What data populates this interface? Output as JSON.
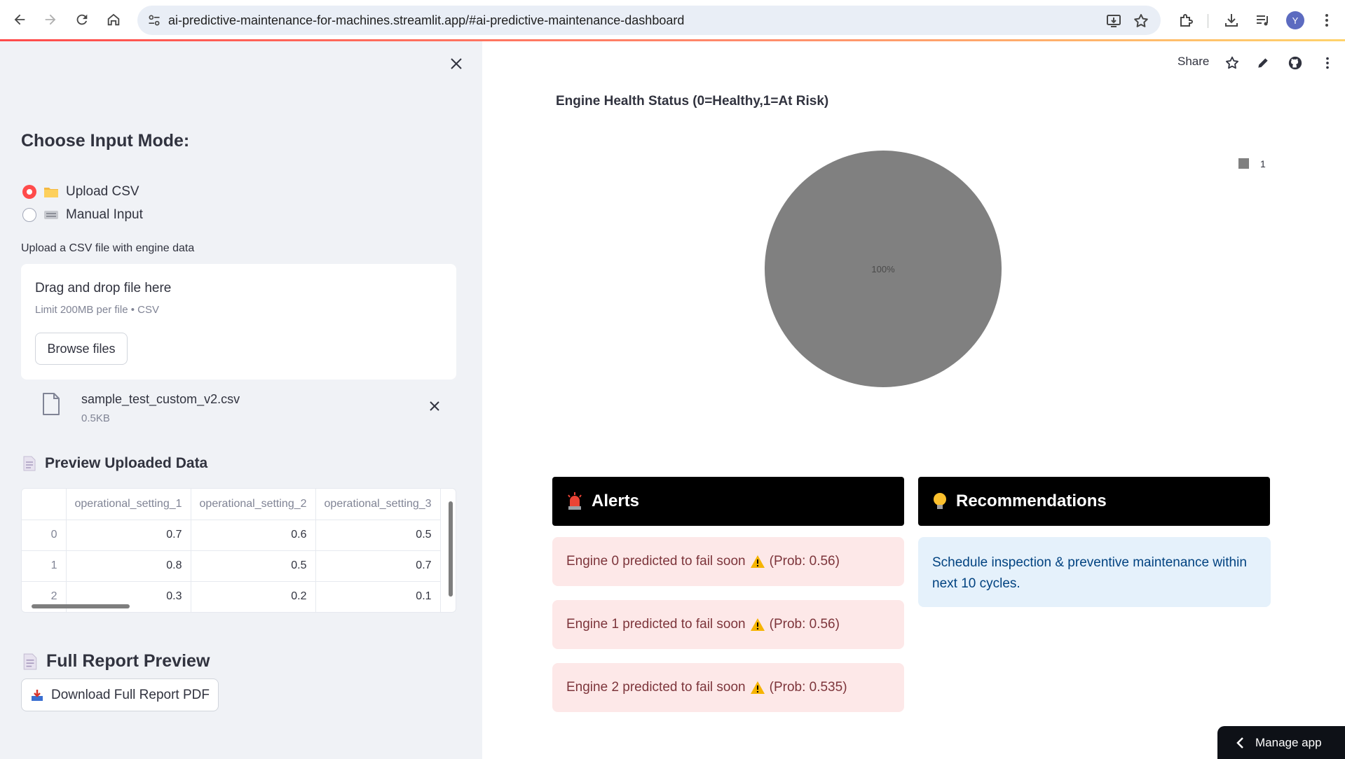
{
  "browser": {
    "url": "ai-predictive-maintenance-for-machines.streamlit.app/#ai-predictive-maintenance-dashboard",
    "avatar_letter": "Y"
  },
  "sidebar": {
    "heading": "Choose Input Mode:",
    "radio_options": [
      {
        "label": "Upload CSV",
        "icon": "folder-icon",
        "selected": true
      },
      {
        "label": "Manual Input",
        "icon": "keyboard-icon",
        "selected": false
      }
    ],
    "uploader": {
      "label": "Upload a CSV file with engine data",
      "drop_text": "Drag and drop file here",
      "limit_text": "Limit 200MB per file • CSV",
      "browse_label": "Browse files"
    },
    "file": {
      "name": "sample_test_custom_v2.csv",
      "size": "0.5KB"
    },
    "preview_heading": "Preview Uploaded Data",
    "table": {
      "columns": [
        "",
        "operational_setting_1",
        "operational_setting_2",
        "operational_setting_3"
      ],
      "rows": [
        [
          "0",
          "0.7",
          "0.6",
          "0.5"
        ],
        [
          "1",
          "0.8",
          "0.5",
          "0.7"
        ],
        [
          "2",
          "0.3",
          "0.2",
          "0.1"
        ]
      ]
    },
    "report_heading": "Full Report Preview",
    "download_label": "Download Full Report PDF"
  },
  "main": {
    "share_label": "Share",
    "chart_title": "Engine Health Status (0=Healthy,1=At Risk)",
    "alerts_title": "Alerts",
    "alerts": [
      {
        "text": "Engine 0 predicted to fail soon",
        "prob": "(Prob: 0.56)"
      },
      {
        "text": "Engine 1 predicted to fail soon",
        "prob": "(Prob: 0.56)"
      },
      {
        "text": "Engine 2 predicted to fail soon",
        "prob": "(Prob: 0.535)"
      }
    ],
    "recommendations_title": "Recommendations",
    "recommendation_text": "Schedule inspection & preventive maintenance within next 10 cycles.",
    "manage_app_label": "Manage app"
  },
  "chart_data": {
    "type": "pie",
    "title": "Engine Health Status (0=Healthy,1=At Risk)",
    "slices": [
      {
        "label": "1",
        "value": 100,
        "color": "#808080",
        "display": "100%"
      }
    ],
    "legend": {
      "placement": "top-right",
      "entries": [
        "1"
      ]
    }
  },
  "colors": {
    "accent": "#ff4b4b",
    "sidebar_bg": "#f0f2f6",
    "alert_bg": "#fde8e8",
    "info_bg": "#e5f1fb",
    "pie_slice": "#808080"
  }
}
